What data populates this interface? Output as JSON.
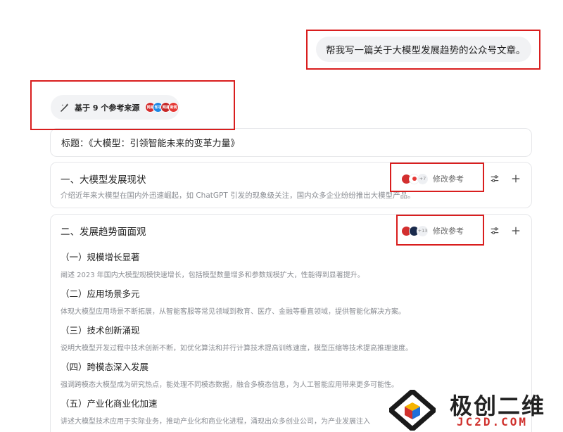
{
  "chat": {
    "user_message": "帮我写一篇关于大模型发展趋势的公众号文章。"
  },
  "references": {
    "label": "基于 9 个参考来源",
    "icon": "magic-wand-icon",
    "source_icons": [
      {
        "name": "source-1-icon",
        "text": "网易",
        "color": "#d32f2f"
      },
      {
        "name": "source-2-icon",
        "text": "知乎",
        "color": "#1e88e5"
      },
      {
        "name": "source-3-icon",
        "text": "网易",
        "color": "#c62828"
      },
      {
        "name": "source-4-icon",
        "text": "新闻",
        "color": "#e53935"
      }
    ]
  },
  "outline": {
    "title": "标题：《大模型：引领智能未来的变革力量》",
    "sections": [
      {
        "title": "一、大模型发展现状",
        "desc": "介绍近年来大模型在国内外迅速崛起，如 ChatGPT 引发的现象级关注，国内众多企业纷纷推出大模型产品。",
        "more_count": "+7",
        "modify_label": "修改参考"
      },
      {
        "title": "二、发展趋势面面观",
        "more_count": "+13",
        "modify_label": "修改参考",
        "subsections": [
          {
            "title": "（一）规模增长显著",
            "desc": "阐述 2023 年国内大模型规模快速增长，包括模型数量增多和参数规模扩大，性能得到显著提升。"
          },
          {
            "title": "（二）应用场景多元",
            "desc": "体现大模型应用场景不断拓展，从智能客服等常见领域到教育、医疗、金融等垂直领域，提供智能化解决方案。"
          },
          {
            "title": "（三）技术创新涌现",
            "desc": "说明大模型开发过程中技术创新不断，如优化算法和并行计算技术提高训练速度，模型压缩等技术提高推理速度。"
          },
          {
            "title": "（四）跨模态深入发展",
            "desc": "强调跨模态大模型成为研究热点，能处理不同模态数据，融合多模态信息，为人工智能应用带来更多可能性。"
          },
          {
            "title": "（五）产业化商业化加速",
            "desc": "讲述大模型技术应用于实际业务，推动产业化和商业化进程，涌现出众多创业公司，为产业发展注入"
          }
        ]
      }
    ]
  },
  "watermark": {
    "text": "极创二维",
    "sub": "JC2D.COM"
  },
  "colors": {
    "highlight": "#d91e1e",
    "card_border": "#e6e7ea",
    "muted_text": "#8a8d93"
  }
}
